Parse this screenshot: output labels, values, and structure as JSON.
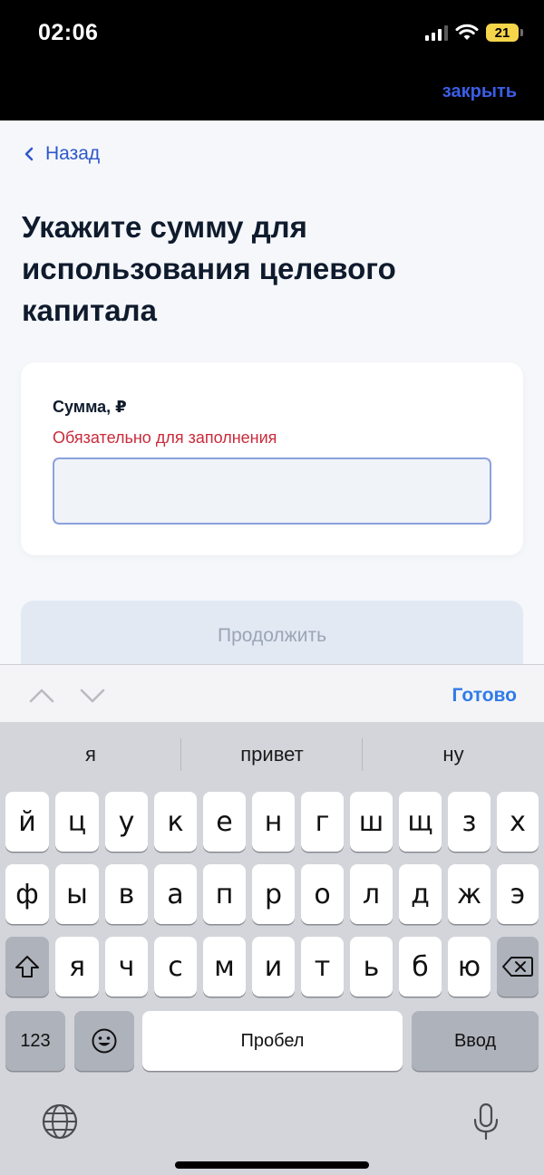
{
  "status_bar": {
    "time": "02:06",
    "battery": "21"
  },
  "browser": {
    "close_label": "закрыть"
  },
  "nav": {
    "back_label": "Назад"
  },
  "page": {
    "title": "Укажите сумму для использования целевого капитала"
  },
  "form": {
    "amount_label": "Сумма, ₽",
    "amount_error": "Обязательно для заполнения",
    "amount_value": ""
  },
  "actions": {
    "continue_label": "Продолжить"
  },
  "accessory_bar": {
    "done_label": "Готово"
  },
  "keyboard": {
    "suggestions": [
      "я",
      "привет",
      "ну"
    ],
    "row1": [
      "й",
      "ц",
      "у",
      "к",
      "е",
      "н",
      "г",
      "ш",
      "щ",
      "з",
      "х"
    ],
    "row2": [
      "ф",
      "ы",
      "в",
      "а",
      "п",
      "р",
      "о",
      "л",
      "д",
      "ж",
      "э"
    ],
    "row3": [
      "я",
      "ч",
      "с",
      "м",
      "и",
      "т",
      "ь",
      "б",
      "ю"
    ],
    "numbers_label": "123",
    "space_label": "Пробел",
    "enter_label": "Ввод"
  },
  "icons": {
    "back": "chevron-left-icon",
    "shift": "shift-icon",
    "backspace": "backspace-icon",
    "emoji": "emoji-icon",
    "globe": "globe-icon",
    "mic": "microphone-icon"
  },
  "colors": {
    "link": "#2f57c9",
    "error": "#c92a3a",
    "done": "#2f7be8",
    "button_disabled_bg": "#e3e9f3"
  }
}
